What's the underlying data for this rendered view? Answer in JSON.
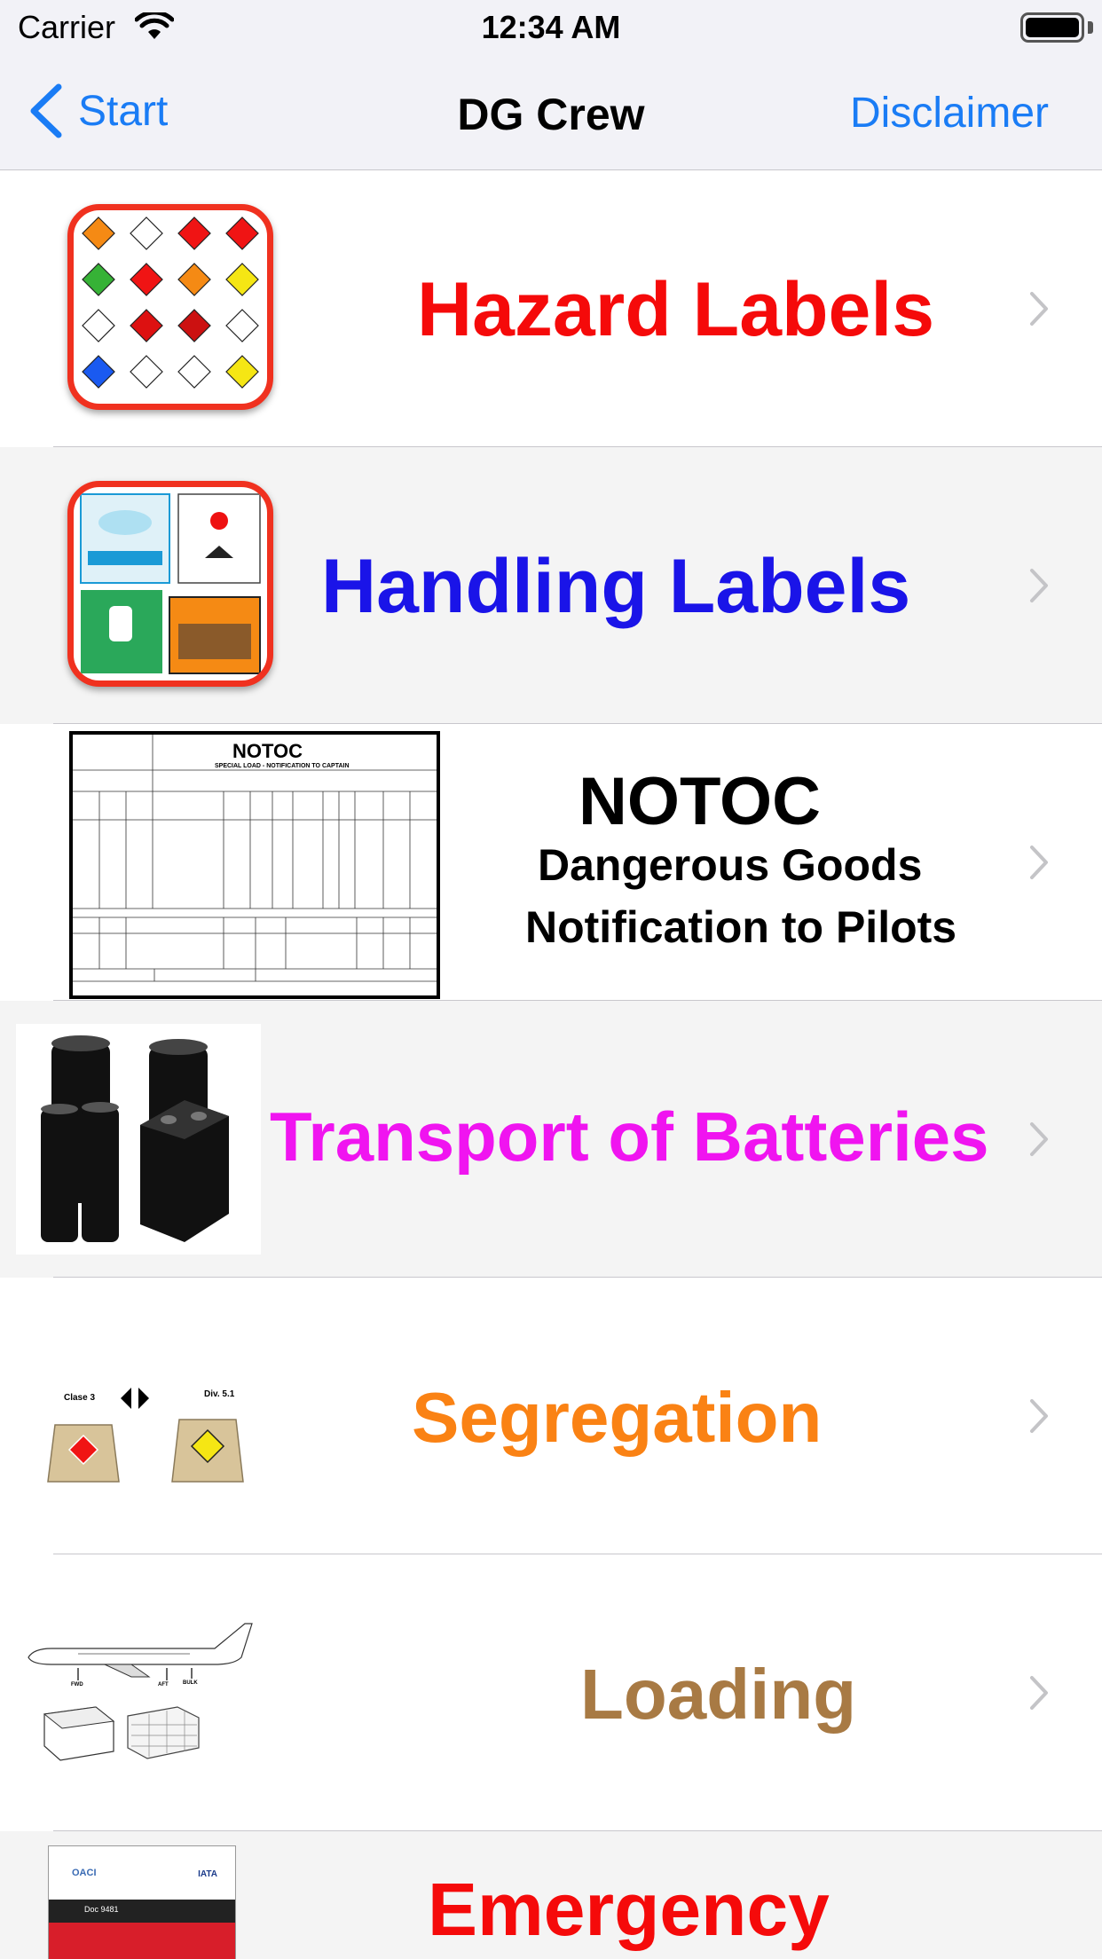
{
  "status_bar": {
    "carrier": "Carrier",
    "time": "12:34 AM"
  },
  "nav": {
    "back_label": "Start",
    "title": "DG Crew",
    "right_label": "Disclaimer"
  },
  "rows": [
    {
      "label": "Hazard   Labels",
      "color": "#f50a0a"
    },
    {
      "label": "Handling Labels",
      "color": "#1a14e8"
    },
    {
      "label_title": "NOTOC",
      "label_line1": "Dangerous Goods",
      "label_line2": "Notification to Pilots",
      "color": "#000000",
      "doc_title": "NOTOC",
      "doc_subtitle": "SPECIAL LOAD - NOTIFICATION TO CAPTAIN"
    },
    {
      "label": "Transport of Batteries",
      "color": "#f014f0"
    },
    {
      "label": "Segregation",
      "color": "#fa8214",
      "img_left": "Clase 3",
      "img_right": "Div. 5.1"
    },
    {
      "label": "Loading",
      "color": "#a87a44",
      "img_fwd": "FWD",
      "img_aft": "AFT",
      "img_bulk": "BULK"
    },
    {
      "label": "Emergency",
      "color": "#f50a0a",
      "doc_org_left": "OACI",
      "doc_org_right": "IATA",
      "doc_code": "Doc 9481"
    }
  ],
  "icons": [
    "wifi-icon",
    "battery-icon",
    "back-chevron-icon",
    "disclosure-chevron-icon"
  ]
}
